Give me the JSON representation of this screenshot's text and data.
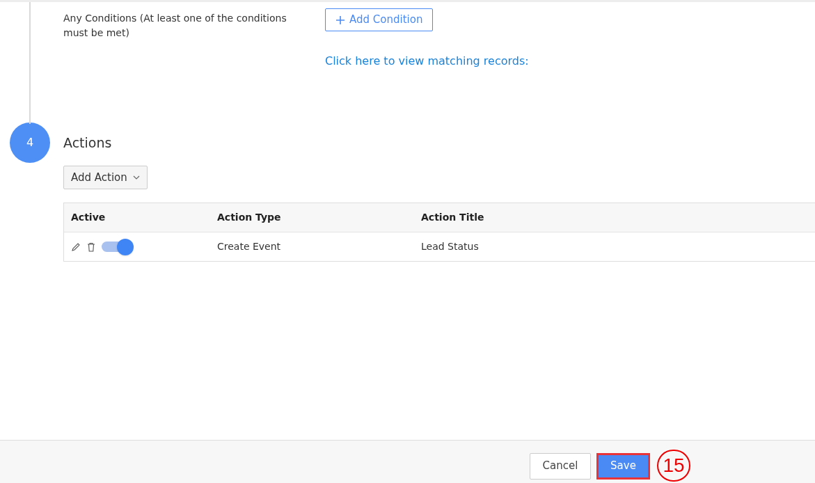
{
  "conditions": {
    "label": "Any Conditions (At least one of the conditions must be met)",
    "add_button": "Add Condition",
    "link": "Click here to view matching records:"
  },
  "step": {
    "number": "4",
    "title": "Actions"
  },
  "add_action": {
    "label": "Add Action"
  },
  "table": {
    "columns": [
      "Active",
      "Action Type",
      "Action Title"
    ],
    "rows": [
      {
        "active": true,
        "action_type": "Create Event",
        "action_title": "Lead Status"
      }
    ]
  },
  "footer": {
    "cancel": "Cancel",
    "save": "Save",
    "callout": "15"
  }
}
